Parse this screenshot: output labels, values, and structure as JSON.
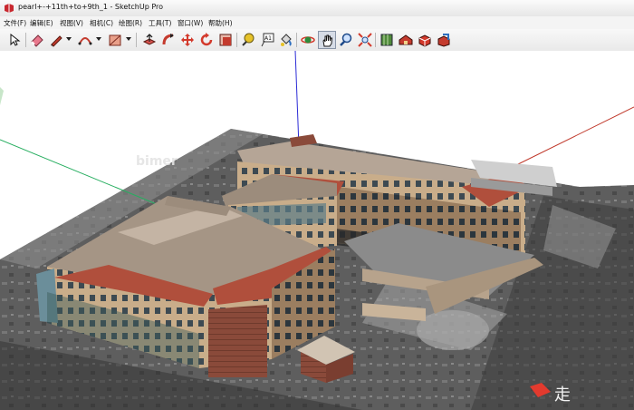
{
  "window": {
    "title": "pearl+-+11th+to+9th_1 - SketchUp Pro"
  },
  "menu": [
    "文件(F)",
    "编辑(E)",
    "视图(V)",
    "相机(C)",
    "绘图(R)",
    "工具(T)",
    "窗口(W)",
    "帮助(H)"
  ],
  "toolbar": {
    "tools": [
      {
        "name": "select-tool",
        "icon": "arrow-cursor-icon"
      },
      {
        "name": "eraser-tool",
        "icon": "eraser-icon"
      },
      {
        "name": "pencil-tool",
        "icon": "pencil-icon"
      },
      {
        "name": "arc-tool",
        "icon": "arc-icon"
      },
      {
        "name": "rectangle-tool",
        "icon": "rectangle-icon"
      },
      {
        "name": "push-pull-tool",
        "icon": "push-pull-icon"
      },
      {
        "name": "follow-me-tool",
        "icon": "follow-me-icon"
      },
      {
        "name": "move-tool",
        "icon": "move-icon"
      },
      {
        "name": "rotate-tool",
        "icon": "rotate-icon"
      },
      {
        "name": "scale-tool",
        "icon": "scale-icon"
      },
      {
        "name": "tape-measure-tool",
        "icon": "tape-measure-icon"
      },
      {
        "name": "text-tool",
        "icon": "text-icon"
      },
      {
        "name": "paint-bucket-tool",
        "icon": "paint-bucket-icon"
      },
      {
        "name": "orbit-tool",
        "icon": "orbit-icon"
      },
      {
        "name": "pan-tool",
        "icon": "hand-icon"
      },
      {
        "name": "zoom-tool",
        "icon": "magnifier-icon"
      },
      {
        "name": "zoom-extents-tool",
        "icon": "zoom-extents-icon"
      },
      {
        "name": "add-location-tool",
        "icon": "map-icon"
      },
      {
        "name": "warehouse-tool",
        "icon": "warehouse-icon"
      },
      {
        "name": "components-tool",
        "icon": "components-icon"
      },
      {
        "name": "share-model-tool",
        "icon": "share-icon"
      }
    ],
    "text_tool_label": "A1",
    "active_tool": "pan-tool"
  },
  "watermark": {
    "text": "bimer",
    "footer": "走"
  },
  "colors": {
    "red_axis": "#c0392b",
    "green_axis": "#27ae60",
    "blue_axis": "#2b2bd6"
  }
}
